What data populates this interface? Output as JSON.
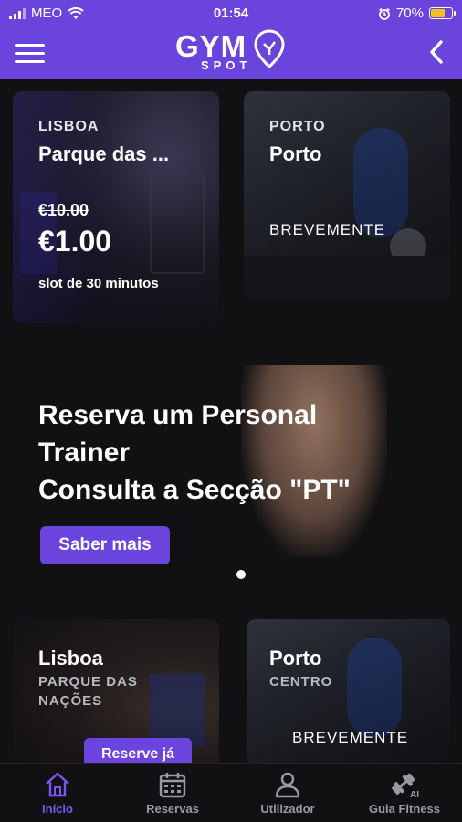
{
  "status": {
    "carrier": "MEO",
    "time": "01:54",
    "battery": "70%",
    "battery_level": 0.7
  },
  "header": {
    "logo_main": "GYM",
    "logo_sub": "SPOT"
  },
  "cards": [
    {
      "city": "LISBOA",
      "title": "Parque das ...",
      "old_price": "€10.00",
      "price": "€1.00",
      "slot": "slot de 30 minutos"
    },
    {
      "city": "PORTO",
      "title": "Porto",
      "status": "BREVEMENTE"
    }
  ],
  "banner": {
    "lines": [
      "Reserva um Personal",
      "Trainer",
      "Consulta a Secção \"PT\""
    ],
    "button": "Saber mais"
  },
  "gyms": [
    {
      "title": "Lisboa",
      "subtitle": "PARQUE DAS NAÇÕES",
      "button": "Reserve já"
    },
    {
      "title": "Porto",
      "subtitle": "CENTRO",
      "status": "BREVEMENTE"
    }
  ],
  "tabs": [
    {
      "label": "Início",
      "icon": "home-icon",
      "active": true
    },
    {
      "label": "Reservas",
      "icon": "calendar-icon"
    },
    {
      "label": "Utilizador",
      "icon": "user-icon"
    },
    {
      "label": "Guia Fitness",
      "icon": "dumbbell-ai-icon"
    }
  ],
  "colors": {
    "accent": "#6a44dc",
    "background": "#111113"
  }
}
